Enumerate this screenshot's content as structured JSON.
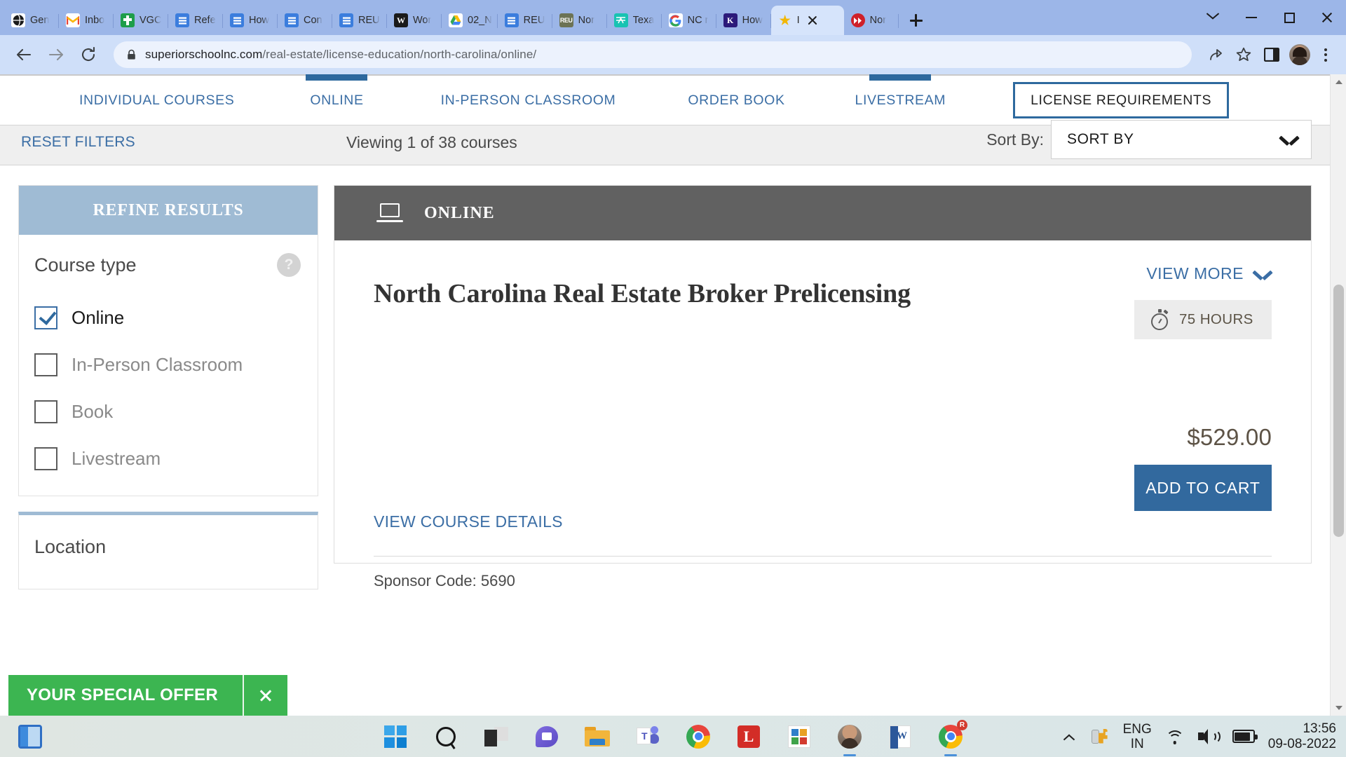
{
  "browser": {
    "tabs": [
      {
        "title": "Gen",
        "icon": "globe-icon",
        "active": false
      },
      {
        "title": "Inbo",
        "icon": "gmail-icon",
        "active": false
      },
      {
        "title": "VGC",
        "icon": "vgc-icon",
        "active": false
      },
      {
        "title": "Refe",
        "icon": "doc-icon",
        "active": false
      },
      {
        "title": "How",
        "icon": "doc-icon",
        "active": false
      },
      {
        "title": "Con",
        "icon": "doc-icon",
        "active": false
      },
      {
        "title": "REU",
        "icon": "doc-icon",
        "active": false
      },
      {
        "title": "Wor",
        "icon": "word-icon",
        "active": false
      },
      {
        "title": "02_N",
        "icon": "google-drive-icon",
        "active": false
      },
      {
        "title": "REU",
        "icon": "doc-icon",
        "active": false
      },
      {
        "title": "Nor",
        "icon": "reu-icon",
        "active": false
      },
      {
        "title": "Texa",
        "icon": "aceable-icon",
        "active": false
      },
      {
        "title": "NC r",
        "icon": "google-icon",
        "active": false
      },
      {
        "title": "How",
        "icon": "k-icon",
        "active": false
      },
      {
        "title": "I",
        "icon": "star-icon",
        "active": true
      },
      {
        "title": "Nor",
        "icon": "fastforward-icon",
        "active": false
      }
    ],
    "new_tab_label": "new-tab",
    "window_controls": {
      "chevron": "chevron-down",
      "minimize": "minimize",
      "maximize": "maximize",
      "close": "close"
    },
    "url_domain": "superiorschoolnc.com",
    "url_path": "/real-estate/license-education/north-carolina/online/",
    "back_label": "Back",
    "forward_label": "Forward",
    "reload_label": "Reload",
    "share_label": "Share",
    "bookmark_label": "Bookmark this tab",
    "sidepanel_label": "Side panel",
    "profile_label": "Profile",
    "menu_label": "Customize and control Google Chrome"
  },
  "site_nav": {
    "items": [
      {
        "label": "INDIVIDUAL COURSES",
        "selected": false,
        "boxed": false
      },
      {
        "label": "ONLINE",
        "selected": true,
        "boxed": false
      },
      {
        "label": "IN-PERSON CLASSROOM",
        "selected": false,
        "boxed": false
      },
      {
        "label": "ORDER BOOK",
        "selected": false,
        "boxed": false
      },
      {
        "label": "LIVESTREAM",
        "selected": true,
        "boxed": false
      },
      {
        "label": "LICENSE REQUIREMENTS",
        "selected": false,
        "boxed": true
      }
    ]
  },
  "filter_bar": {
    "reset_filters": "RESET FILTERS",
    "viewing_text": "Viewing 1 of 38 courses",
    "sort_label": "Sort By:",
    "sort_value": "SORT BY",
    "sort_options": [
      "SORT BY"
    ]
  },
  "sidebar": {
    "panel_title": "REFINE RESULTS",
    "course_type": {
      "title": "Course type",
      "help": "?",
      "options": [
        {
          "label": "Online",
          "checked": true
        },
        {
          "label": "In-Person Classroom",
          "checked": false
        },
        {
          "label": "Book",
          "checked": false
        },
        {
          "label": "Livestream",
          "checked": false
        }
      ]
    },
    "location": {
      "title": "Location"
    }
  },
  "course_card": {
    "badge": "ONLINE",
    "badge_icon": "laptop-icon",
    "view_more": "VIEW MORE",
    "title": "North Carolina Real Estate Broker Prelicensing",
    "hours": "75 HOURS",
    "hours_icon": "stopwatch-icon",
    "price": "$529.00",
    "add_to_cart": "ADD TO CART",
    "view_course_details": "VIEW COURSE DETAILS",
    "sponsor_code": "Sponsor Code: 5690"
  },
  "special_offer": {
    "label": "YOUR SPECIAL OFFER",
    "close": "×"
  },
  "taskbar": {
    "widgets_icon": "widgets-icon",
    "items": [
      {
        "name": "start-button",
        "icon": "windows-logo-icon"
      },
      {
        "name": "search-button",
        "icon": "search-icon"
      },
      {
        "name": "task-view-button",
        "icon": "task-view-icon"
      },
      {
        "name": "chat-button",
        "icon": "chat-icon"
      },
      {
        "name": "file-explorer-button",
        "icon": "folder-icon"
      },
      {
        "name": "teams-button",
        "icon": "teams-icon"
      },
      {
        "name": "edge-button",
        "icon": "chrome-icon"
      },
      {
        "name": "lastpass-button",
        "icon": "lastpass-icon"
      },
      {
        "name": "microsoft-store-button",
        "icon": "store-icon"
      },
      {
        "name": "photos-button",
        "icon": "photo-icon"
      },
      {
        "name": "word-button",
        "icon": "word-icon"
      },
      {
        "name": "chrome-button",
        "icon": "chrome-icon"
      }
    ],
    "tray": {
      "show_hidden": "show-hidden-icons",
      "keys_icon": "keys-icon",
      "language_line1": "ENG",
      "language_line2": "IN",
      "wifi_icon": "wifi-icon",
      "volume_icon": "volume-icon",
      "battery_icon": "battery-icon",
      "time": "13:56",
      "date": "09-08-2022"
    }
  },
  "colors": {
    "brand_blue": "#2e699e",
    "link_blue": "#3b6ea5",
    "panel_header": "#9fbbd4",
    "card_header": "#616161",
    "offer_green": "#3cb551",
    "chrome_tabstrip": "#9cb6e8"
  }
}
